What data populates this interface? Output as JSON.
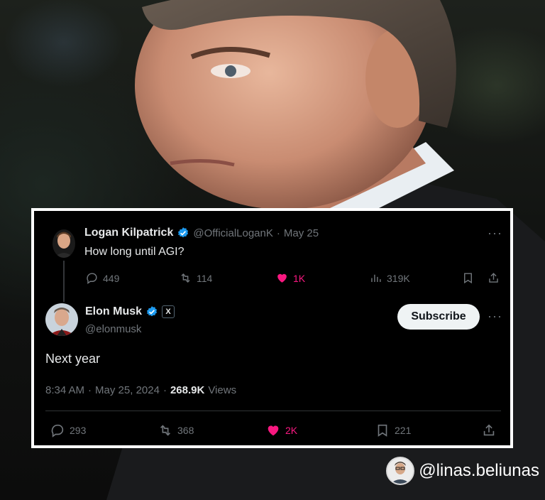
{
  "quoted_tweet": {
    "author_name": "Logan Kilpatrick",
    "handle": "@OfficialLoganK",
    "separator": "·",
    "date": "May 25",
    "text": "How long until AGI?",
    "replies": "449",
    "reposts": "114",
    "likes": "1K",
    "views": "319K"
  },
  "main_tweet": {
    "author_name": "Elon Musk",
    "handle": "@elonmusk",
    "badge_letter": "X",
    "subscribe_label": "Subscribe",
    "text": "Next year",
    "time": "8:34 AM",
    "separator": "·",
    "date": "May 25, 2024",
    "views_count": "268.9K",
    "views_label": "Views",
    "replies": "293",
    "reposts": "368",
    "likes": "2K",
    "bookmarks": "221"
  },
  "watermark": {
    "text": "@linas.beliunas"
  },
  "colors": {
    "like_active": "#f91880",
    "verified": "#1d9bf0",
    "muted": "#71767b"
  },
  "icons": [
    "reply-icon",
    "repost-icon",
    "like-icon",
    "views-icon",
    "bookmark-icon",
    "share-icon",
    "verified-icon",
    "more-icon"
  ]
}
